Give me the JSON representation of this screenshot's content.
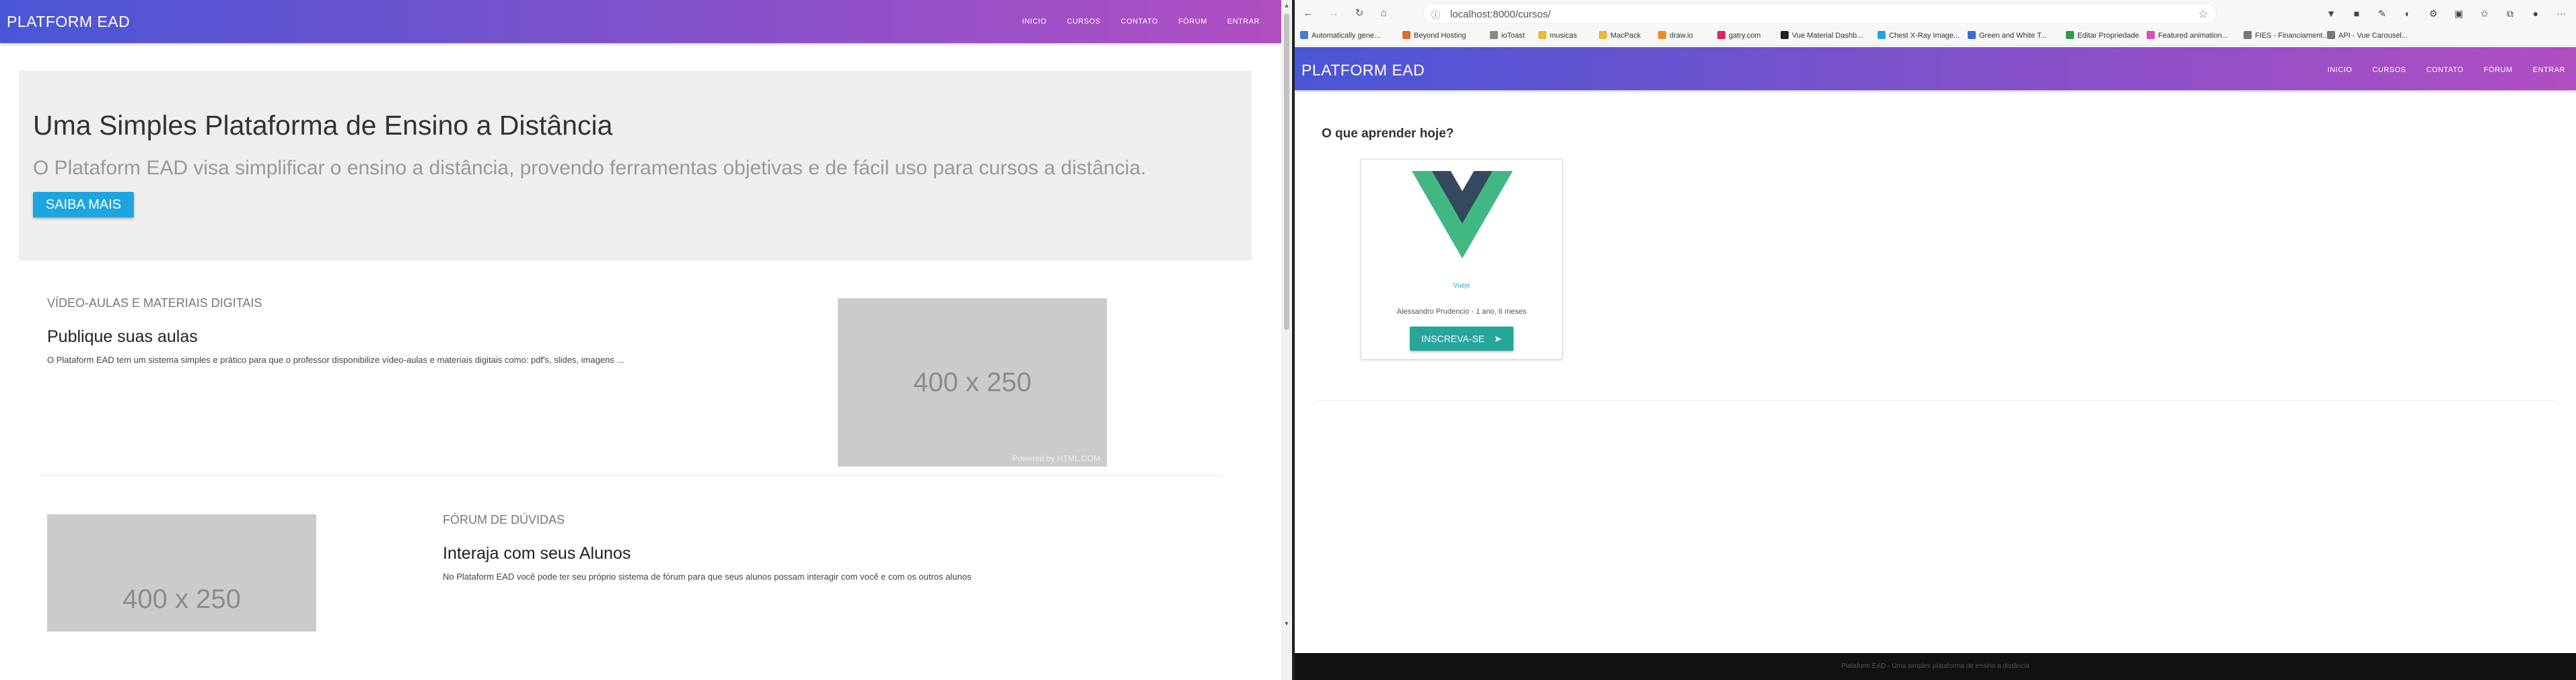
{
  "left": {
    "brand": "PLATFORM EAD",
    "nav": [
      "INICIO",
      "CURSOS",
      "CONTATO",
      "FÓRUM",
      "ENTRAR"
    ],
    "hero": {
      "title": "Uma Simples Plataforma de Ensino a Distância",
      "lead": "O Plataform EAD visa simplificar o ensino a distância, provendo ferramentas objetivas e de fácil uso para cursos a distância.",
      "button": "SAIBA MAIS"
    },
    "feature1": {
      "kicker": "VÍDEO-AULAS E MATERIAIS DIGITAIS",
      "title": "Publique suas aulas",
      "desc": "O Plataform EAD tem um sistema simples e prático para que o professor disponibilize vídeo-aulas e materiais digitais como: pdf's, slides, imagens ...",
      "image_text": "400 x 250",
      "image_credit": "Powered by HTML.COM"
    },
    "feature2": {
      "kicker": "FÓRUM DE DÚVIDAS",
      "title": "Interaja com seus Alunos",
      "desc": "No Plataform EAD você pode ter seu próprio sistema de fórum para que seus alunos possam interagir com você e com os outros alunos",
      "image_text": "400 x 250"
    }
  },
  "right": {
    "url": "localhost:8000/cursos/",
    "bookmarks": [
      {
        "label": "Automatically gene...",
        "color": "#4a7bd0"
      },
      {
        "label": "Beyond Hosting",
        "color": "#e06b2a"
      },
      {
        "label": "ioToast",
        "color": "#888888"
      },
      {
        "label": "musicas",
        "color": "#e9b93a"
      },
      {
        "label": "MacPack",
        "color": "#e9b93a"
      },
      {
        "label": "draw.io",
        "color": "#f08c1e"
      },
      {
        "label": "gatry.com",
        "color": "#e0245e"
      },
      {
        "label": "Vue Material Dashb...",
        "color": "#222222"
      },
      {
        "label": "Chest X-Ray Image...",
        "color": "#20a4e0"
      },
      {
        "label": "Green and White T...",
        "color": "#3a6fd8"
      },
      {
        "label": "Editar Propriedade",
        "color": "#2e9d48"
      },
      {
        "label": "Featured animation...",
        "color": "#e04ab8"
      },
      {
        "label": "FIES - Financiament...",
        "color": "#777777"
      },
      {
        "label": "API - Vue Carousel...",
        "color": "#777777"
      }
    ],
    "brand": "PLATFORM EAD",
    "nav": [
      "INICIO",
      "CURSOS",
      "CONTATO",
      "FÓRUM",
      "ENTRAR"
    ],
    "section_title": "O que aprender hoje?",
    "course": {
      "name": "Vuejs",
      "author": "Alessandro Prudencio - 1 ano, 6 meses",
      "button": "INSCREVA-SE"
    },
    "footer": "Plataform EAD - Uma simples plataforma de ensino a distância"
  },
  "colors": {
    "navbar_start": "#4a56d6",
    "navbar_end": "#b14ec2",
    "saiba_button": "#1ea5e0",
    "inscreva_button": "#26a69a",
    "vue_green": "#41b883",
    "vue_dark": "#35495e"
  }
}
